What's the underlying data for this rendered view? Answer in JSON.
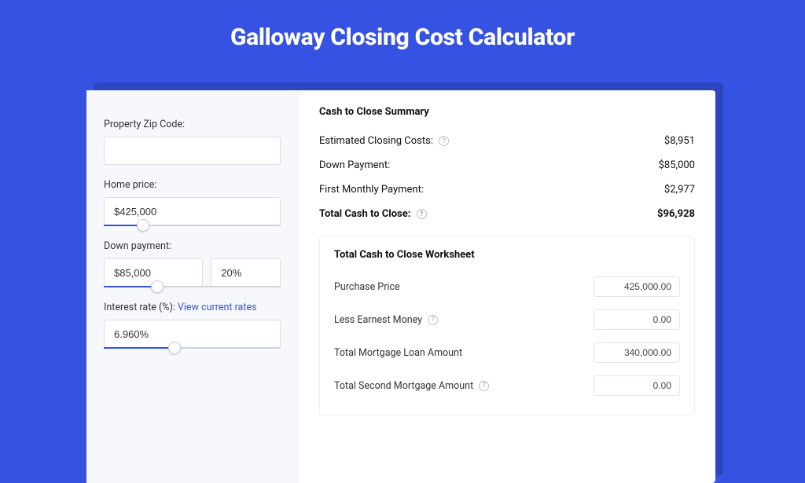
{
  "title": "Galloway Closing Cost Calculator",
  "left": {
    "zip_label": "Property Zip Code:",
    "zip_value": "",
    "home_price_label": "Home price:",
    "home_price_value": "$425,000",
    "home_price_slider_percent": 22,
    "down_payment_label": "Down payment:",
    "down_payment_value": "$85,000",
    "down_payment_pct_value": "20%",
    "down_payment_slider_percent": 30,
    "interest_label_prefix": "Interest rate (%): ",
    "interest_link_text": "View current rates",
    "interest_value": "6.960%",
    "interest_slider_percent": 40
  },
  "summary": {
    "heading": "Cash to Close Summary",
    "rows": [
      {
        "label": "Estimated Closing Costs:",
        "value": "$8,951",
        "help": true
      },
      {
        "label": "Down Payment:",
        "value": "$85,000",
        "help": false
      },
      {
        "label": "First Monthly Payment:",
        "value": "$2,977",
        "help": false
      }
    ],
    "total_label": "Total Cash to Close:",
    "total_value": "$96,928"
  },
  "worksheet": {
    "heading": "Total Cash to Close Worksheet",
    "rows": [
      {
        "label": "Purchase Price",
        "value": "425,000.00",
        "help": false
      },
      {
        "label": "Less Earnest Money",
        "value": "0.00",
        "help": true
      },
      {
        "label": "Total Mortgage Loan Amount",
        "value": "340,000.00",
        "help": false
      },
      {
        "label": "Total Second Mortgage Amount",
        "value": "0.00",
        "help": true
      }
    ]
  }
}
